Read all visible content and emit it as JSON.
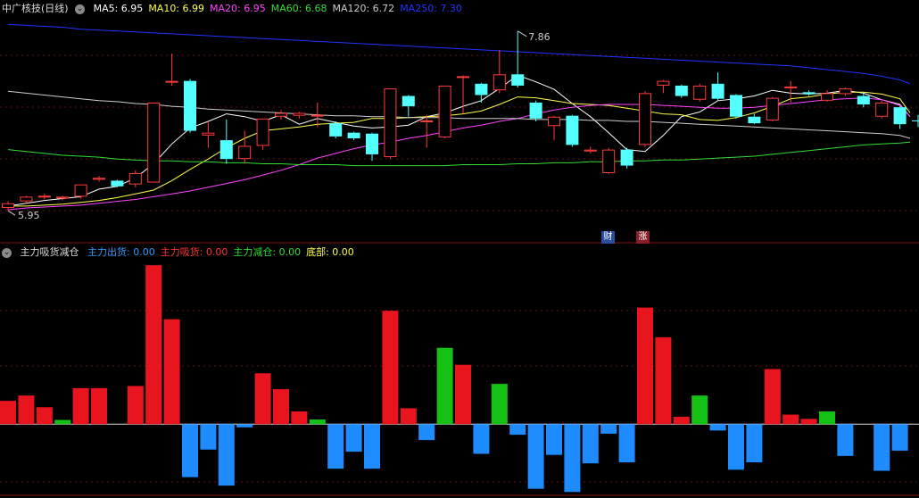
{
  "main_header": {
    "title": "中广核技(日线)",
    "ma_labels": [
      {
        "text": "MA5: 6.95",
        "color": "#ffffff"
      },
      {
        "text": "MA10: 6.99",
        "color": "#ffff4a"
      },
      {
        "text": "MA20: 6.95",
        "color": "#ff44ff"
      },
      {
        "text": "MA60: 6.68",
        "color": "#33dd33"
      },
      {
        "text": "MA120: 6.72",
        "color": "#cccccc"
      },
      {
        "text": "MA250: 7.30",
        "color": "#2233ff"
      }
    ]
  },
  "sub_header": {
    "title": "主力吸货减仓",
    "labels": [
      {
        "text": "主力出货: 0.00",
        "color": "#3399ff"
      },
      {
        "text": "主力吸货: 0.00",
        "color": "#ff3333"
      },
      {
        "text": "主力减仓: 0.00",
        "color": "#33dd33"
      },
      {
        "text": "底部: 0.00",
        "color": "#ffff4a"
      }
    ]
  },
  "badges": [
    {
      "text": "财",
      "color": "#2a4fa0"
    },
    {
      "text": "涨",
      "color": "#8a1e28"
    }
  ],
  "chart_data": [
    {
      "type": "candlestick",
      "high_label": "7.86",
      "low_label": "5.95",
      "y_range": [
        5.8,
        8.0
      ],
      "candles": [
        {
          "o": 5.98,
          "c": 6.03,
          "h": 6.05,
          "l": 5.95,
          "up": true
        },
        {
          "o": 6.05,
          "c": 6.1,
          "h": 6.11,
          "l": 6.03,
          "up": true
        },
        {
          "o": 6.1,
          "c": 6.11,
          "h": 6.13,
          "l": 6.07,
          "up": true
        },
        {
          "o": 6.08,
          "c": 6.1,
          "h": 6.11,
          "l": 6.06,
          "up": true
        },
        {
          "o": 6.1,
          "c": 6.23,
          "h": 6.23,
          "l": 6.08,
          "up": true
        },
        {
          "o": 6.28,
          "c": 6.3,
          "h": 6.32,
          "l": 6.26,
          "up": true
        },
        {
          "o": 6.27,
          "c": 6.21,
          "h": 6.28,
          "l": 6.2,
          "up": false
        },
        {
          "o": 6.23,
          "c": 6.35,
          "h": 6.38,
          "l": 6.2,
          "up": true
        },
        {
          "o": 6.25,
          "c": 7.1,
          "h": 7.1,
          "l": 6.25,
          "up": true
        },
        {
          "o": 7.32,
          "c": 7.33,
          "h": 7.62,
          "l": 7.28,
          "up": true
        },
        {
          "o": 7.33,
          "c": 6.8,
          "h": 7.35,
          "l": 6.78,
          "up": false
        },
        {
          "o": 6.75,
          "c": 6.78,
          "h": 6.9,
          "l": 6.62,
          "up": true
        },
        {
          "o": 6.7,
          "c": 6.5,
          "h": 6.92,
          "l": 6.45,
          "up": false
        },
        {
          "o": 6.5,
          "c": 6.64,
          "h": 6.8,
          "l": 6.45,
          "up": true
        },
        {
          "o": 6.64,
          "c": 6.93,
          "h": 6.93,
          "l": 6.6,
          "up": true
        },
        {
          "o": 6.95,
          "c": 6.99,
          "h": 7.02,
          "l": 6.92,
          "up": true
        },
        {
          "o": 6.96,
          "c": 6.99,
          "h": 7.0,
          "l": 6.93,
          "up": true
        },
        {
          "o": 6.96,
          "c": 6.97,
          "h": 7.1,
          "l": 6.84,
          "up": true
        },
        {
          "o": 6.88,
          "c": 6.74,
          "h": 6.9,
          "l": 6.72,
          "up": false
        },
        {
          "o": 6.78,
          "c": 6.72,
          "h": 6.79,
          "l": 6.7,
          "up": false
        },
        {
          "o": 6.77,
          "c": 6.55,
          "h": 6.78,
          "l": 6.48,
          "up": false
        },
        {
          "o": 6.52,
          "c": 7.25,
          "h": 7.25,
          "l": 6.5,
          "up": true
        },
        {
          "o": 7.17,
          "c": 7.06,
          "h": 7.18,
          "l": 6.95,
          "up": false
        },
        {
          "o": 6.9,
          "c": 6.91,
          "h": 6.97,
          "l": 6.62,
          "up": true
        },
        {
          "o": 6.73,
          "c": 7.28,
          "h": 7.28,
          "l": 6.72,
          "up": true
        },
        {
          "o": 7.38,
          "c": 7.38,
          "h": 7.39,
          "l": 6.98,
          "up": true
        },
        {
          "o": 7.3,
          "c": 7.18,
          "h": 7.31,
          "l": 7.1,
          "up": false
        },
        {
          "o": 7.23,
          "c": 7.4,
          "h": 7.66,
          "l": 7.2,
          "up": true
        },
        {
          "o": 7.4,
          "c": 7.28,
          "h": 7.86,
          "l": 7.26,
          "up": false
        },
        {
          "o": 7.1,
          "c": 6.93,
          "h": 7.12,
          "l": 6.9,
          "up": false
        },
        {
          "o": 6.85,
          "c": 6.95,
          "h": 6.96,
          "l": 6.7,
          "up": true
        },
        {
          "o": 6.96,
          "c": 6.65,
          "h": 6.97,
          "l": 6.63,
          "up": false
        },
        {
          "o": 6.58,
          "c": 6.6,
          "h": 6.63,
          "l": 6.56,
          "up": true
        },
        {
          "o": 6.35,
          "c": 6.6,
          "h": 6.62,
          "l": 6.34,
          "up": true
        },
        {
          "o": 6.6,
          "c": 6.43,
          "h": 6.62,
          "l": 6.4,
          "up": false
        },
        {
          "o": 6.65,
          "c": 7.2,
          "h": 7.22,
          "l": 6.63,
          "up": true
        },
        {
          "o": 7.28,
          "c": 7.33,
          "h": 7.34,
          "l": 7.2,
          "up": true
        },
        {
          "o": 7.28,
          "c": 7.17,
          "h": 7.29,
          "l": 7.15,
          "up": false
        },
        {
          "o": 7.13,
          "c": 7.28,
          "h": 7.3,
          "l": 7.11,
          "up": true
        },
        {
          "o": 7.3,
          "c": 7.14,
          "h": 7.42,
          "l": 7.12,
          "up": false
        },
        {
          "o": 7.18,
          "c": 6.95,
          "h": 7.19,
          "l": 6.93,
          "up": false
        },
        {
          "o": 6.88,
          "c": 6.95,
          "h": 6.98,
          "l": 6.87,
          "up": false
        },
        {
          "o": 6.91,
          "c": 7.15,
          "h": 7.16,
          "l": 6.9,
          "up": true
        },
        {
          "o": 7.25,
          "c": 7.27,
          "h": 7.33,
          "l": 7.1,
          "up": true
        },
        {
          "o": 7.21,
          "c": 7.19,
          "h": 7.23,
          "l": 7.17,
          "up": false
        },
        {
          "o": 7.12,
          "c": 7.2,
          "h": 7.23,
          "l": 7.11,
          "up": true
        },
        {
          "o": 7.19,
          "c": 7.25,
          "h": 7.26,
          "l": 7.17,
          "up": true
        },
        {
          "o": 7.17,
          "c": 7.08,
          "h": 7.2,
          "l": 7.05,
          "up": false
        },
        {
          "o": 6.95,
          "c": 7.1,
          "h": 7.12,
          "l": 6.93,
          "up": true
        },
        {
          "o": 7.05,
          "c": 6.87,
          "h": 7.06,
          "l": 6.82,
          "up": false
        },
        {
          "o": 6.9,
          "c": 6.91,
          "h": 6.97,
          "l": 6.84,
          "up": false
        }
      ],
      "ma_series": [
        {
          "name": "MA5",
          "color": "#ffffff",
          "values": [
            6.0,
            6.03,
            6.06,
            6.08,
            6.1,
            6.18,
            6.21,
            6.3,
            6.45,
            6.66,
            6.83,
            6.9,
            6.98,
            6.95,
            6.9,
            6.97,
            6.87,
            6.93,
            6.89,
            6.85,
            6.83,
            6.84,
            6.86,
            6.95,
            6.99,
            7.06,
            7.12,
            7.25,
            7.39,
            7.32,
            7.24,
            7.09,
            6.95,
            6.78,
            6.6,
            6.58,
            6.75,
            6.95,
            7.0,
            7.12,
            7.14,
            7.17,
            7.23,
            7.2,
            7.19,
            7.2,
            7.23,
            7.2,
            7.13,
            7.08,
            6.95
          ]
        },
        {
          "name": "MA10",
          "color": "#ffff4a",
          "values": [
            6.0,
            6.0,
            6.01,
            6.02,
            6.04,
            6.06,
            6.09,
            6.13,
            6.17,
            6.27,
            6.39,
            6.5,
            6.62,
            6.72,
            6.8,
            6.82,
            6.84,
            6.87,
            6.88,
            6.89,
            6.93,
            6.93,
            6.94,
            6.95,
            6.96,
            6.98,
            7.01,
            7.08,
            7.16,
            7.15,
            7.12,
            7.09,
            7.08,
            7.07,
            7.04,
            7.01,
            6.98,
            6.97,
            6.92,
            6.91,
            6.94,
            6.99,
            7.06,
            7.14,
            7.16,
            7.19,
            7.21,
            7.21,
            7.19,
            7.14,
            6.99
          ]
        },
        {
          "name": "MA20",
          "color": "#ff44ff",
          "values": [
            5.96,
            5.98,
            5.99,
            6.0,
            6.01,
            6.03,
            6.05,
            6.07,
            6.1,
            6.13,
            6.16,
            6.2,
            6.24,
            6.28,
            6.33,
            6.38,
            6.44,
            6.51,
            6.56,
            6.61,
            6.65,
            6.68,
            6.72,
            6.75,
            6.79,
            6.83,
            6.86,
            6.9,
            6.93,
            6.98,
            7.02,
            7.05,
            7.07,
            7.08,
            7.08,
            7.08,
            7.07,
            7.06,
            7.05,
            7.04,
            7.04,
            7.05,
            7.07,
            7.09,
            7.11,
            7.13,
            7.14,
            7.15,
            7.13,
            7.07,
            6.95
          ]
        },
        {
          "name": "MA60",
          "color": "#33dd33",
          "values": [
            6.6,
            6.58,
            6.56,
            6.54,
            6.53,
            6.52,
            6.5,
            6.49,
            6.48,
            6.48,
            6.47,
            6.47,
            6.46,
            6.46,
            6.45,
            6.45,
            6.44,
            6.44,
            6.44,
            6.43,
            6.43,
            6.43,
            6.43,
            6.43,
            6.43,
            6.44,
            6.44,
            6.44,
            6.45,
            6.45,
            6.46,
            6.46,
            6.47,
            6.47,
            6.48,
            6.48,
            6.49,
            6.49,
            6.5,
            6.51,
            6.52,
            6.53,
            6.55,
            6.57,
            6.59,
            6.61,
            6.63,
            6.65,
            6.66,
            6.67,
            6.68
          ]
        },
        {
          "name": "MA120",
          "color": "#cccccc",
          "values": [
            7.22,
            7.2,
            7.18,
            7.16,
            7.14,
            7.12,
            7.11,
            7.09,
            7.08,
            7.06,
            7.05,
            7.03,
            7.02,
            7.01,
            7.0,
            6.99,
            6.98,
            6.97,
            6.96,
            6.96,
            6.95,
            6.95,
            6.94,
            6.94,
            6.94,
            6.93,
            6.93,
            6.93,
            6.93,
            6.92,
            6.92,
            6.92,
            6.91,
            6.91,
            6.9,
            6.9,
            6.89,
            6.88,
            6.87,
            6.86,
            6.85,
            6.84,
            6.83,
            6.82,
            6.81,
            6.8,
            6.79,
            6.78,
            6.77,
            6.75,
            6.72
          ]
        },
        {
          "name": "MA250",
          "color": "#2233ff",
          "values": [
            7.93,
            7.92,
            7.91,
            7.9,
            7.88,
            7.87,
            7.86,
            7.85,
            7.84,
            7.83,
            7.82,
            7.81,
            7.8,
            7.79,
            7.78,
            7.77,
            7.76,
            7.75,
            7.74,
            7.73,
            7.72,
            7.71,
            7.7,
            7.69,
            7.68,
            7.67,
            7.66,
            7.65,
            7.64,
            7.63,
            7.62,
            7.61,
            7.6,
            7.59,
            7.58,
            7.57,
            7.56,
            7.55,
            7.54,
            7.53,
            7.52,
            7.51,
            7.5,
            7.49,
            7.47,
            7.45,
            7.43,
            7.41,
            7.38,
            7.34,
            7.3
          ]
        }
      ]
    },
    {
      "type": "bar",
      "y_range": [
        -3.4,
        7.8
      ],
      "bars": [
        {
          "v": 1.1,
          "c": "red"
        },
        {
          "v": 1.35,
          "c": "red"
        },
        {
          "v": 0.8,
          "c": "red"
        },
        {
          "v": 0.2,
          "c": "green"
        },
        {
          "v": 1.7,
          "c": "red"
        },
        {
          "v": 1.7,
          "c": "red"
        },
        {
          "v": 0,
          "c": "none"
        },
        {
          "v": 1.8,
          "c": "red"
        },
        {
          "v": 7.5,
          "c": "red"
        },
        {
          "v": 4.95,
          "c": "red"
        },
        {
          "v": -2.5,
          "c": "blue"
        },
        {
          "v": -1.2,
          "c": "blue"
        },
        {
          "v": -2.9,
          "c": "blue"
        },
        {
          "v": -0.15,
          "c": "blue"
        },
        {
          "v": 2.4,
          "c": "red"
        },
        {
          "v": 1.65,
          "c": "red"
        },
        {
          "v": 0.6,
          "c": "red"
        },
        {
          "v": 0.22,
          "c": "green"
        },
        {
          "v": -2.1,
          "c": "blue"
        },
        {
          "v": -1.3,
          "c": "blue"
        },
        {
          "v": -2.1,
          "c": "blue"
        },
        {
          "v": 5.35,
          "c": "red"
        },
        {
          "v": 0.75,
          "c": "red"
        },
        {
          "v": -0.75,
          "c": "blue"
        },
        {
          "v": 3.6,
          "c": "green"
        },
        {
          "v": 2.8,
          "c": "red"
        },
        {
          "v": -1.4,
          "c": "blue"
        },
        {
          "v": 1.9,
          "c": "green"
        },
        {
          "v": -0.5,
          "c": "blue"
        },
        {
          "v": -3.05,
          "c": "blue"
        },
        {
          "v": -1.45,
          "c": "blue"
        },
        {
          "v": -3.2,
          "c": "blue"
        },
        {
          "v": -1.85,
          "c": "blue"
        },
        {
          "v": -0.45,
          "c": "blue"
        },
        {
          "v": -1.8,
          "c": "blue"
        },
        {
          "v": 5.5,
          "c": "red"
        },
        {
          "v": 4.1,
          "c": "red"
        },
        {
          "v": 0.35,
          "c": "red"
        },
        {
          "v": 1.35,
          "c": "green"
        },
        {
          "v": -0.3,
          "c": "blue"
        },
        {
          "v": -2.15,
          "c": "blue"
        },
        {
          "v": -1.8,
          "c": "blue"
        },
        {
          "v": 2.6,
          "c": "red"
        },
        {
          "v": 0.45,
          "c": "red"
        },
        {
          "v": 0.25,
          "c": "red"
        },
        {
          "v": 0.6,
          "c": "green"
        },
        {
          "v": -1.5,
          "c": "blue"
        },
        {
          "v": 0,
          "c": "none"
        },
        {
          "v": -2.2,
          "c": "blue"
        },
        {
          "v": -1.25,
          "c": "blue"
        }
      ]
    }
  ]
}
